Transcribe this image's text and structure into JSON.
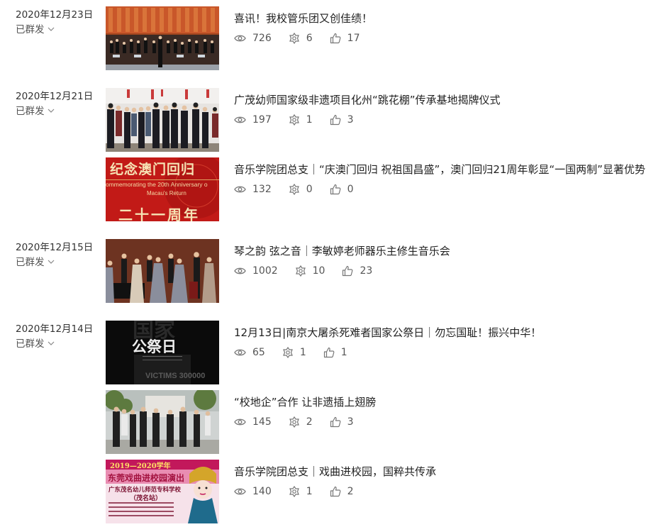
{
  "groups": [
    {
      "date": "2020年12月23日",
      "status": "已群发",
      "articles": [
        {
          "title": "喜讯！我校管乐团又创佳绩！",
          "views": "726",
          "shares": "6",
          "likes": "17"
        }
      ]
    },
    {
      "date": "2020年12月21日",
      "status": "已群发",
      "articles": [
        {
          "title": "广茂幼师国家级非遗项目化州“跳花棚”传承基地揭牌仪式",
          "views": "197",
          "shares": "1",
          "likes": "3"
        },
        {
          "title": "音乐学院团总支｜“庆澳门回归 祝祖国昌盛”，澳门回归21周年彰显“一国两制”显著优势",
          "views": "132",
          "shares": "0",
          "likes": "0",
          "thumb_text": {
            "heading": "纪念澳门回归",
            "subtitle": "ommemorating the 20th Anniversary o",
            "subtitle2": "Macau's Return",
            "footer": "二十一周年"
          }
        }
      ]
    },
    {
      "date": "2020年12月15日",
      "status": "已群发",
      "articles": [
        {
          "title": "琴之韵 弦之音｜李敏婷老师器乐主修生音乐会",
          "views": "1002",
          "shares": "10",
          "likes": "23"
        }
      ]
    },
    {
      "date": "2020年12月14日",
      "status": "已群发",
      "articles": [
        {
          "title": "12月13日|南京大屠杀死难者国家公祭日｜勿忘国耻！振兴中华！",
          "views": "65",
          "shares": "1",
          "likes": "1",
          "thumb_text": {
            "top": "国家",
            "main": "公祭日",
            "bottom": "VICTIMS 300000"
          }
        },
        {
          "title": "“校地企”合作 让非遗插上翅膀",
          "views": "145",
          "shares": "2",
          "likes": "3"
        },
        {
          "title": "音乐学院团总支｜戏曲进校园，国粹共传承",
          "views": "140",
          "shares": "1",
          "likes": "2",
          "thumb_text": {
            "top": "2019—2020学年",
            "main": "东莞戏曲进校园演出",
            "school": "广东茂名幼儿师范专科学校",
            "station": "（茂名站）"
          }
        }
      ]
    }
  ]
}
